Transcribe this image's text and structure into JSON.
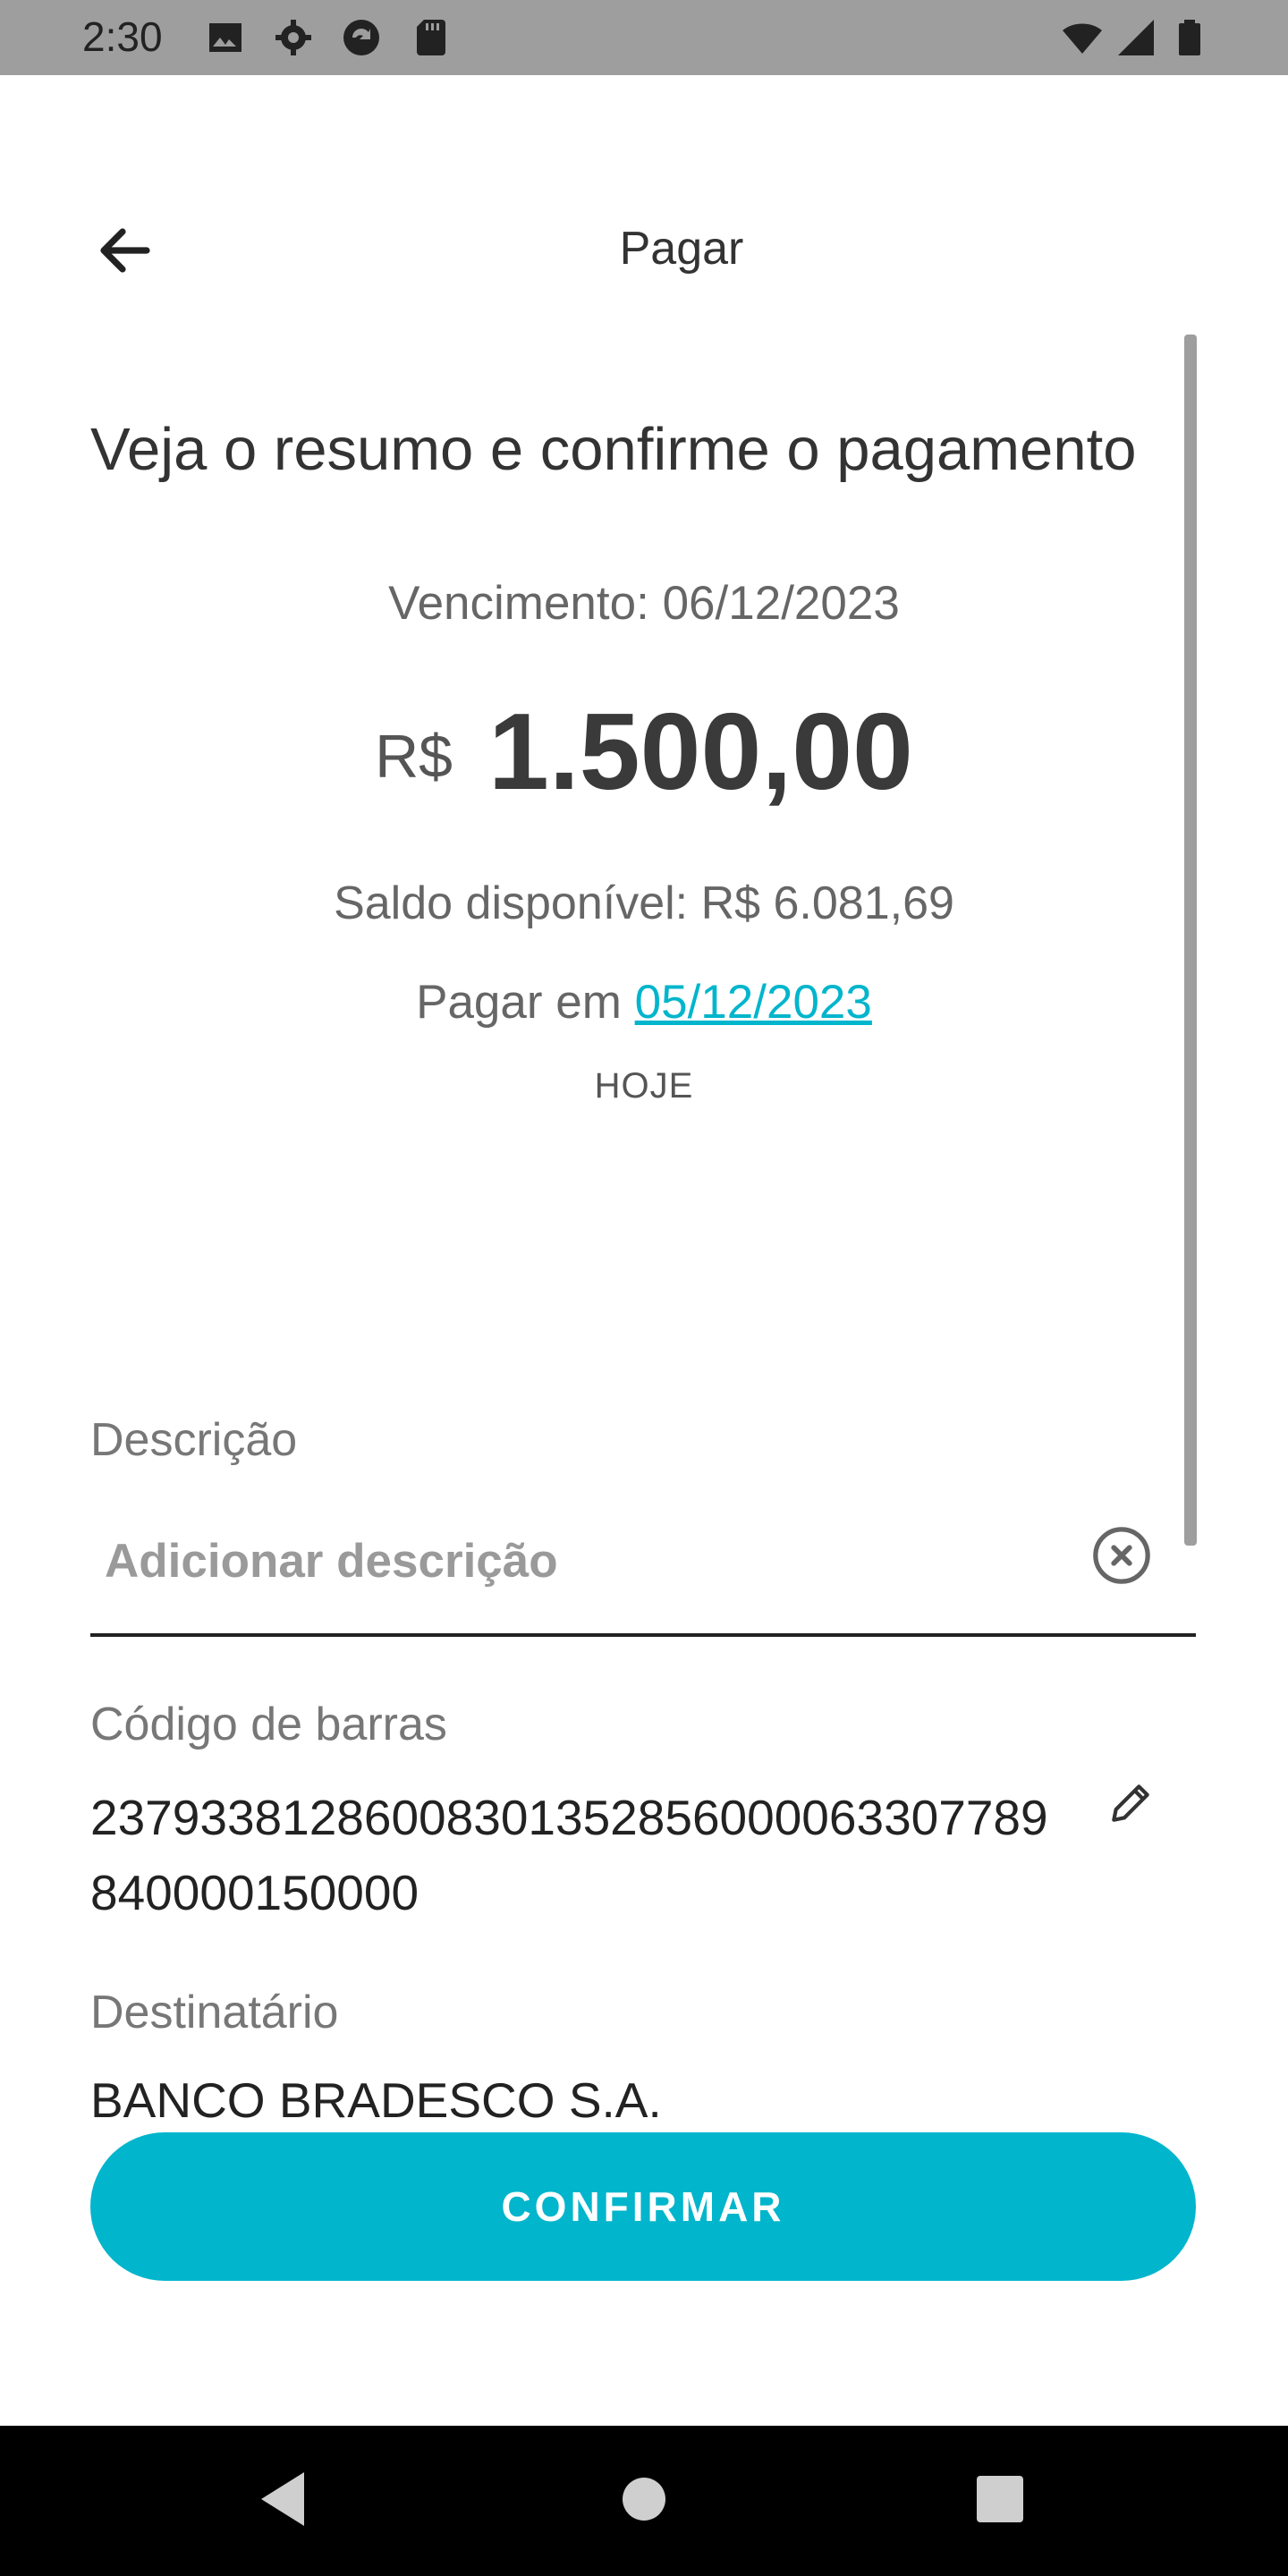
{
  "status_bar": {
    "time": "2:30"
  },
  "app_bar": {
    "title": "Pagar"
  },
  "summary": {
    "heading": "Veja o resumo e confirme o pagamento",
    "due_date": "Vencimento: 06/12/2023",
    "currency": "R$",
    "amount": "1.500,00",
    "balance": "Saldo disponível: R$ 6.081,69",
    "pay_on_prefix": "Pagar em ",
    "pay_on_date": "05/12/2023",
    "pay_on_caption": "HOJE"
  },
  "description": {
    "label": "Descrição",
    "placeholder": "Adicionar descrição",
    "value": ""
  },
  "barcode": {
    "label": "Código de barras",
    "value": "23793381286008301352856000063307789840000150000"
  },
  "recipient": {
    "label": "Destinatário",
    "value": "BANCO BRADESCO S.A."
  },
  "actions": {
    "confirm_label": "CONFIRMAR"
  },
  "colors": {
    "accent": "#00b5cc",
    "status_bar": "#9e9e9e"
  },
  "icons": [
    "image-icon",
    "gear-icon",
    "sync-icon",
    "sd-card-icon",
    "wifi-icon",
    "signal-icon",
    "battery-icon",
    "back-arrow-icon",
    "clear-icon",
    "edit-icon"
  ]
}
